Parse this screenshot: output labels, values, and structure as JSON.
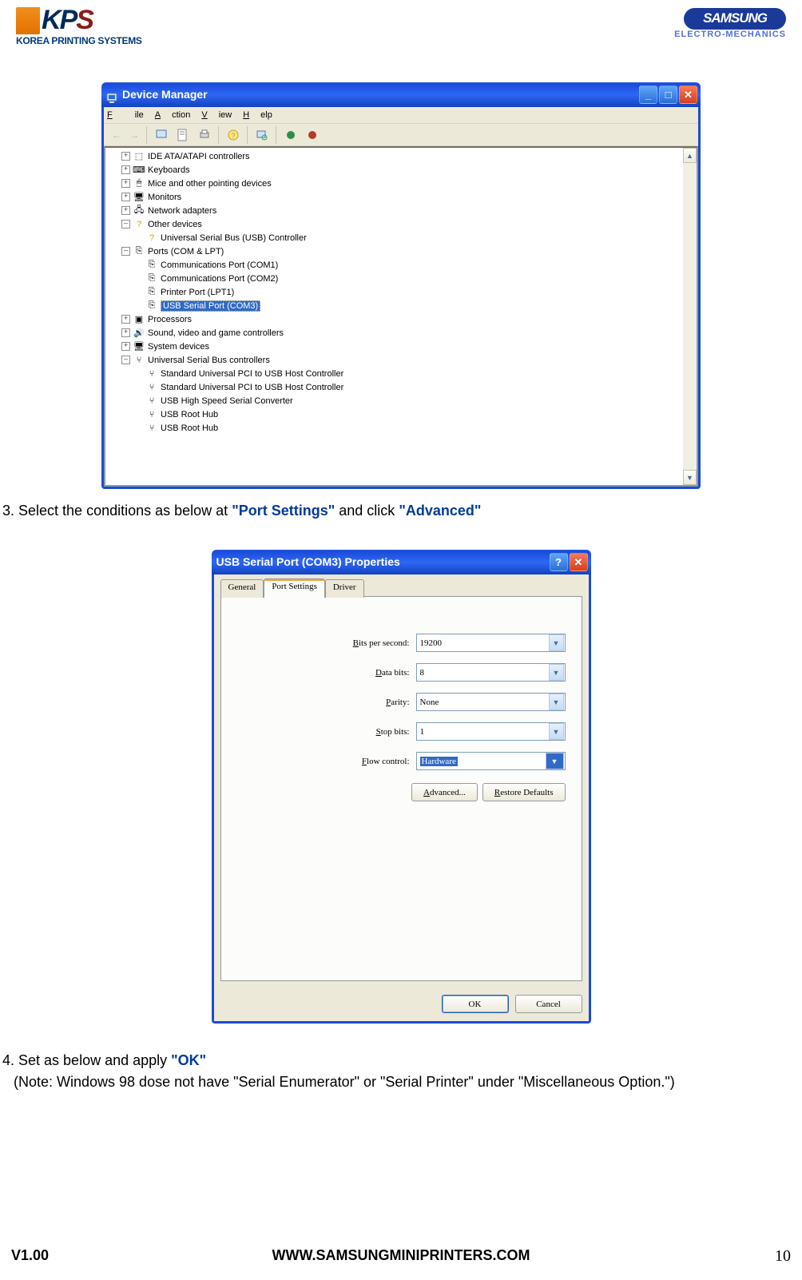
{
  "header": {
    "kps_sub": "KOREA PRINTING SYSTEMS",
    "samsung": "SAMSUNG",
    "samsung_sub": "ELECTRO-MECHANICS"
  },
  "dm": {
    "title": "Device Manager",
    "menu": {
      "file": "File",
      "action": "Action",
      "view": "View",
      "help": "Help"
    },
    "tree": {
      "ide": "IDE ATA/ATAPI controllers",
      "keyboards": "Keyboards",
      "mice": "Mice and other pointing devices",
      "monitors": "Monitors",
      "network": "Network adapters",
      "other": "Other devices",
      "usb_controller": "Universal Serial Bus (USB) Controller",
      "ports": "Ports (COM & LPT)",
      "com1": "Communications Port (COM1)",
      "com2": "Communications Port (COM2)",
      "lpt1": "Printer Port (LPT1)",
      "com3": "USB Serial Port (COM3)",
      "processors": "Processors",
      "sound": "Sound, video and game controllers",
      "system": "System devices",
      "usb": "Universal Serial Bus controllers",
      "pci1": "Standard Universal PCI to USB Host Controller",
      "pci2": "Standard Universal PCI to USB Host Controller",
      "hsconv": "USB High Speed Serial Converter",
      "root1": "USB Root Hub",
      "root2": "USB Root Hub"
    }
  },
  "instr3": {
    "pre": "3. Select the conditions as below at ",
    "q1": "\"Port Settings\"",
    "mid": " and click ",
    "q2": "\"Advanced\""
  },
  "prop": {
    "title": "USB Serial Port (COM3) Properties",
    "tabs": {
      "general": "General",
      "port": "Port Settings",
      "driver": "Driver"
    },
    "labels": {
      "bps": "Bits per second:",
      "data": "Data bits:",
      "parity": "Parity:",
      "stop": "Stop bits:",
      "flow": "Flow control:"
    },
    "uls": {
      "bps": "B",
      "data": "D",
      "parity": "P",
      "stop": "S",
      "flow": "F"
    },
    "values": {
      "bps": "19200",
      "data": "8",
      "parity": "None",
      "stop": "1",
      "flow": "Hardware"
    },
    "buttons": {
      "advanced": "Advanced...",
      "adv_ul": "A",
      "restore": "Restore Defaults",
      "res_ul": "R",
      "ok": "OK",
      "cancel": "Cancel"
    }
  },
  "instr4": {
    "pre": "4. Set as below and apply ",
    "q": "\"OK\""
  },
  "note": "(Note: Windows 98 dose not have \"Serial Enumerator\" or \"Serial Printer\" under \"Miscellaneous Option.\")",
  "footer": {
    "version": "V1.00",
    "url": "WWW.SAMSUNGMINIPRINTERS.COM",
    "page": "10"
  }
}
